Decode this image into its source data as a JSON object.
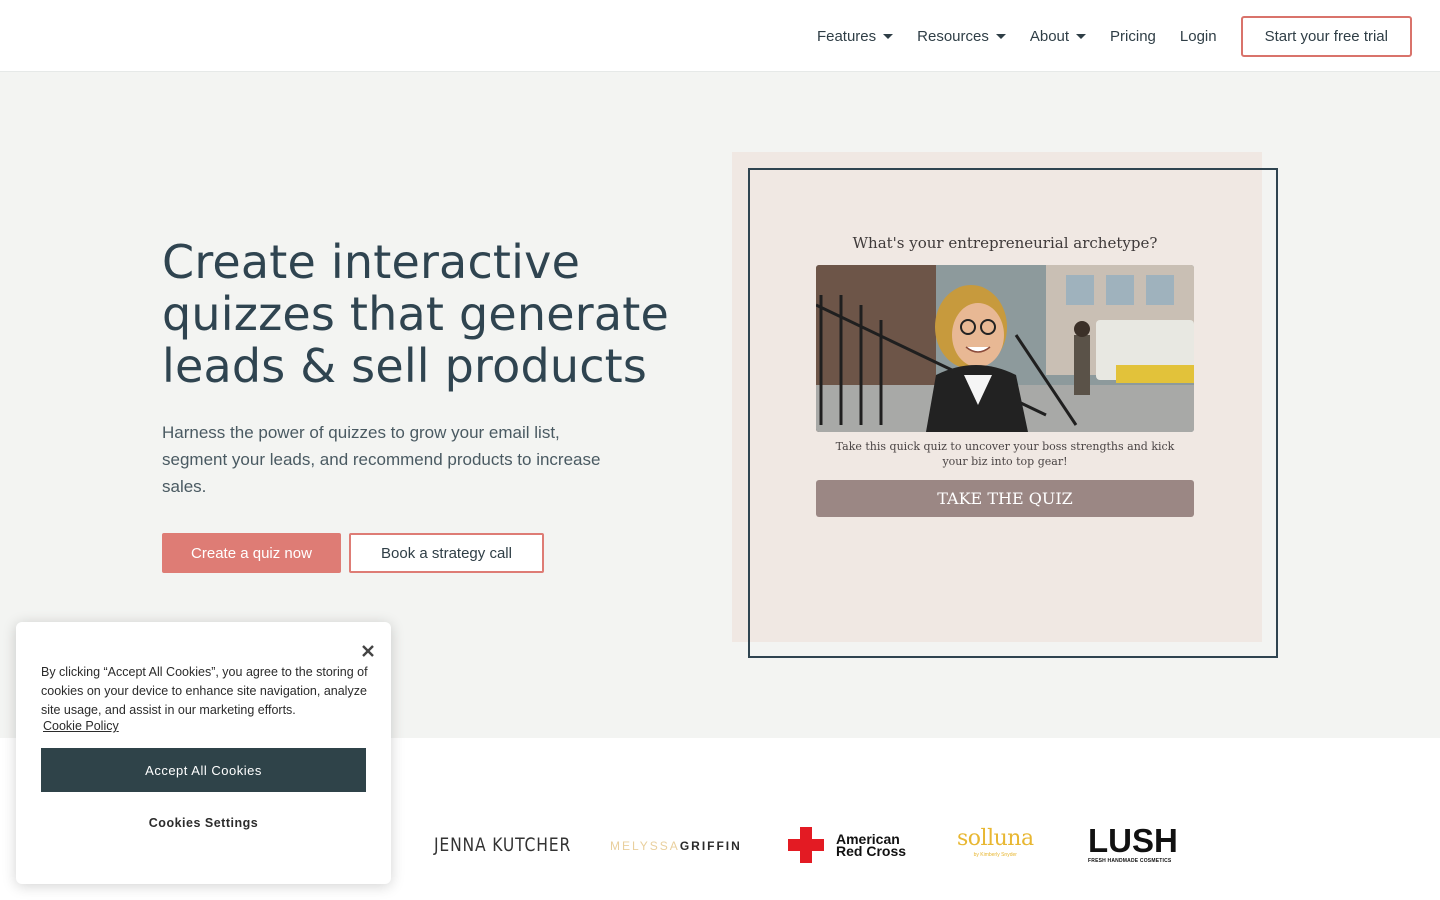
{
  "nav": {
    "items": [
      {
        "label": "Features",
        "dropdown": true
      },
      {
        "label": "Resources",
        "dropdown": true
      },
      {
        "label": "About",
        "dropdown": true
      },
      {
        "label": "Pricing",
        "dropdown": false
      },
      {
        "label": "Login",
        "dropdown": false
      }
    ],
    "cta": "Start your free trial"
  },
  "hero": {
    "title_line1": "Create interactive",
    "title_line2": "quizzes that generate",
    "title_line3": "leads & sell products",
    "subtitle": "Harness the power of quizzes to grow your email list, segment your leads, and recommend products to increase sales.",
    "primary_cta": "Create a quiz now",
    "secondary_cta": "Book a strategy call"
  },
  "quiz_preview": {
    "title": "What's your entrepreneurial archetype?",
    "description": "Take this quick quiz to uncover your boss strengths and kick your biz into top gear!",
    "button": "TAKE THE QUIZ",
    "image_icon": "smiling-woman-photo"
  },
  "logos": {
    "jenna": "JENNA KUTCHER",
    "melyssa_part1": "MELYSSA",
    "melyssa_part2": "GRIFFIN",
    "arc_line1": "American",
    "arc_line2": "Red Cross",
    "solluna": "solluna",
    "solluna_sub": "by Kimberly Snyder",
    "lush": "LUSH",
    "lush_sub": "FRESH HANDMADE COSMETICS"
  },
  "cookie": {
    "text": "By clicking “Accept All Cookies”, you agree to the storing of cookies on your device to enhance site navigation, analyze site usage, and assist in our marketing efforts.",
    "policy_link": "Cookie Policy",
    "accept": "Accept All Cookies",
    "settings": "Cookies Settings"
  },
  "colors": {
    "accent": "#de7c75",
    "dark": "#2f4450",
    "hero_bg": "#f3f4f2",
    "quiz_bg": "#f0e8e3",
    "quiz_button": "#9b8784"
  }
}
